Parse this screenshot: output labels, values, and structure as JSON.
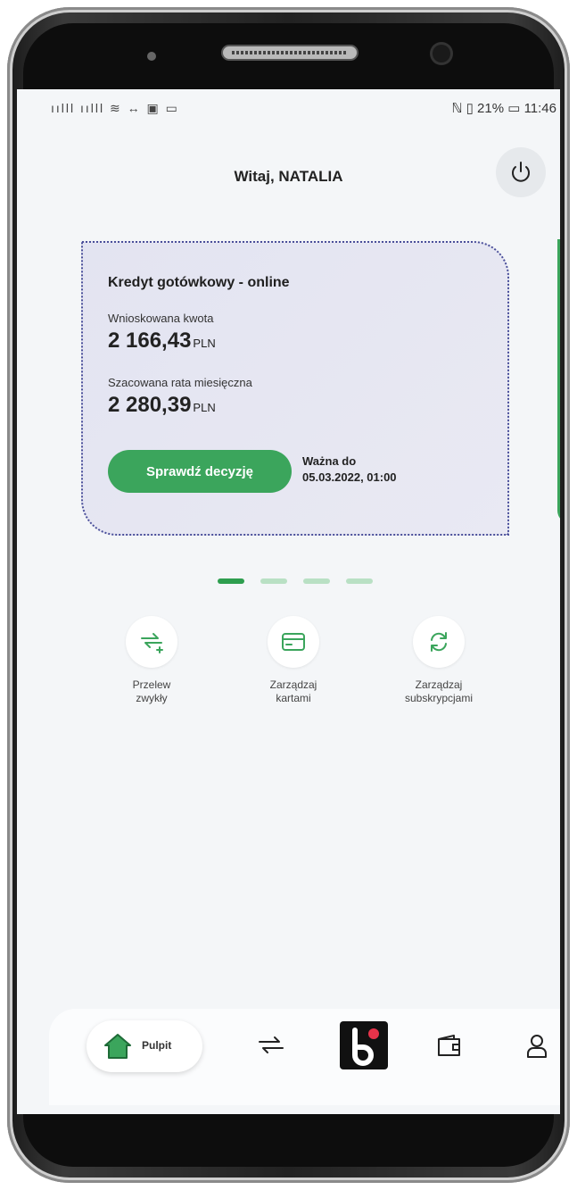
{
  "status": {
    "left_icons": "ıılll  ıılll ≋ ↔ ▣ ▭",
    "right_text": "ℕ ▯ 21% ▭ 11:46"
  },
  "header": {
    "greeting": "Witaj, NATALIA",
    "power_icon": "power-icon"
  },
  "offer": {
    "title": "Kredyt gotówkowy - online",
    "requested_label": "Wnioskowana kwota",
    "requested_value": "2 166,43",
    "requested_currency": "PLN",
    "installment_label": "Szacowana rata miesięczna",
    "installment_value": "2 280,39",
    "installment_currency": "PLN",
    "button_label": "Sprawdź decyzję",
    "valid_label": "Ważna do",
    "valid_value": "05.03.2022, 01:00"
  },
  "pager": {
    "count": 4,
    "active_index": 0
  },
  "quick_actions": [
    {
      "label_line1": "Przelew",
      "label_line2": "zwykły",
      "icon": "transfer-icon"
    },
    {
      "label_line1": "Zarządzaj",
      "label_line2": "kartami",
      "icon": "card-icon"
    },
    {
      "label_line1": "Zarządzaj",
      "label_line2": "subskrypcjami",
      "icon": "refresh-icon"
    }
  ],
  "nav": {
    "home_label": "Pulpit",
    "items": [
      "home-icon",
      "transfer-icon",
      "blik-icon",
      "wallet-icon",
      "profile-icon"
    ]
  },
  "colors": {
    "accent_green": "#3ba55c",
    "card_border": "#4a4f9a"
  }
}
